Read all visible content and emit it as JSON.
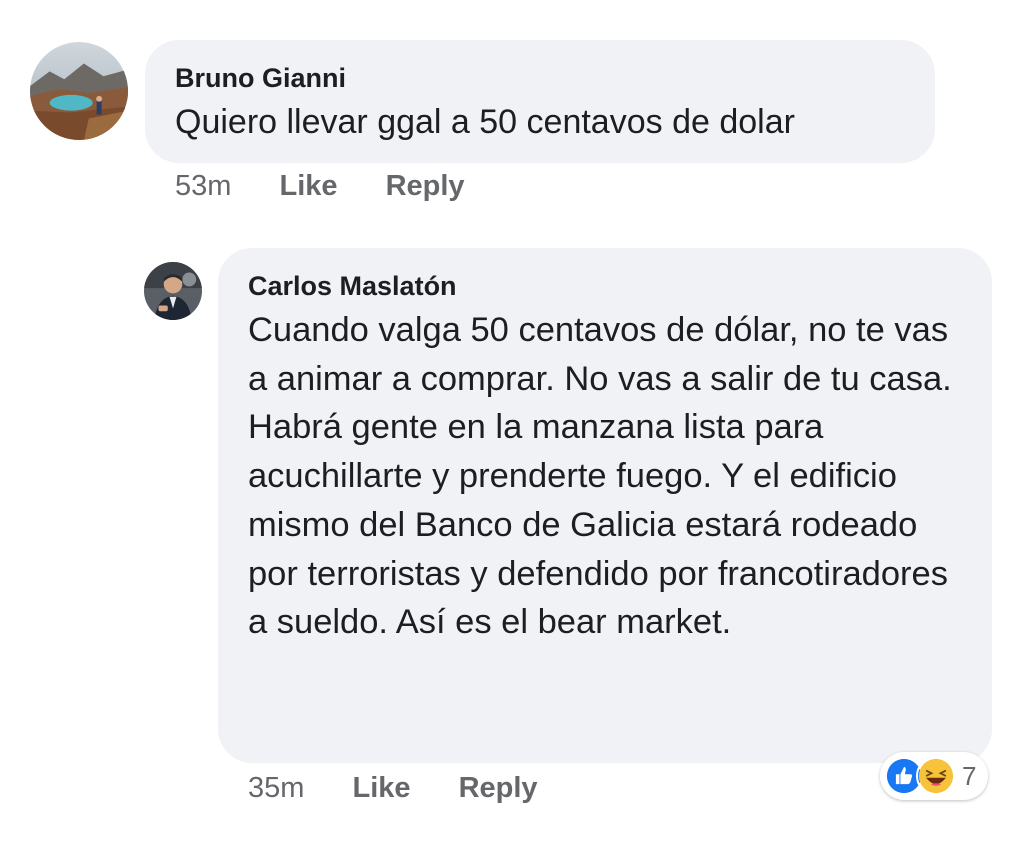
{
  "comments": [
    {
      "author": "Bruno Gianni",
      "text": "Quiero llevar ggal a 50 centavos de dolar",
      "time": "53m",
      "like_label": "Like",
      "reply_label": "Reply",
      "avatar": "landscape-photo"
    },
    {
      "author": "Carlos Maslatón",
      "text": "Cuando valga 50 centavos de dólar, no te vas a animar a comprar. No vas a salir de tu casa. Habrá gente en la manzana lista para acuchillarte y prenderte fuego. Y el edificio mismo del Banco de Galicia estará rodeado por terroristas y defendido por francotiradores a sueldo. Así es el bear market.",
      "time": "35m",
      "like_label": "Like",
      "reply_label": "Reply",
      "avatar": "person-photo",
      "reactions": {
        "icons": [
          "like-icon",
          "haha-icon"
        ],
        "count": "7"
      }
    }
  ],
  "colors": {
    "bubble": "#f0f2f5",
    "text": "#1c1e21",
    "meta": "#65676b",
    "like_blue": "#1877f2",
    "haha_yellow": "#f7c33b"
  }
}
